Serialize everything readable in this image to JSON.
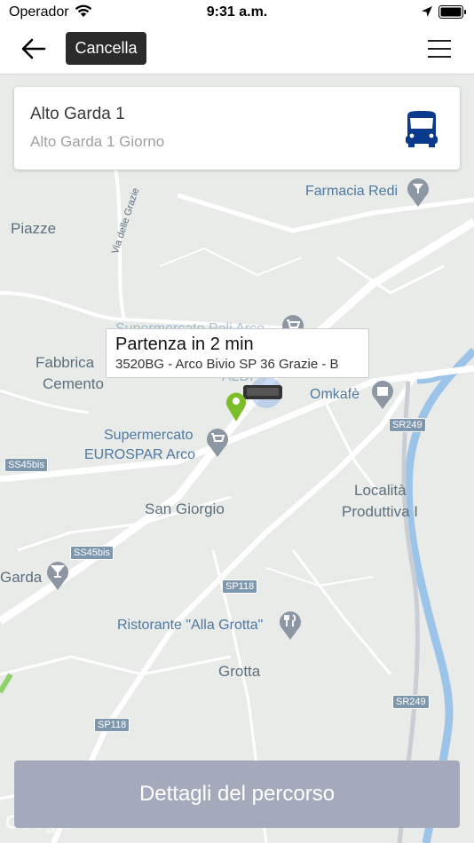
{
  "status_bar": {
    "carrier": "Operador",
    "time": "9:31 a.m."
  },
  "nav": {
    "cancel_label": "Cancella"
  },
  "route_card": {
    "name": "Alto Garda 1",
    "subtitle": "Alto Garda 1 Giorno"
  },
  "callout": {
    "title": "Partenza in 2 min",
    "stop": "3520BG - Arco Bivio SP 36 Grazie - B"
  },
  "map": {
    "places": [
      "Piazze",
      "Fabbrica",
      "Cemento",
      "San Giorgio",
      "Località",
      "Produttiva I",
      "Garda",
      "Grotta"
    ],
    "pois": [
      "Farmacia Redi",
      "Supermercato Poli Arco",
      "Omkafè",
      "Supermercato",
      "EUROSPAR Arco",
      "Ristorante \"Alla Grotta\"",
      "ALDI"
    ],
    "street": "Via delle Grazie",
    "road_tags": [
      "SS45bis",
      "SS45bis",
      "SP118",
      "SP118",
      "SR249",
      "SR249"
    ]
  },
  "details_button": "Dettagli del percorso",
  "logo": "Google",
  "colors": {
    "accent_blue": "#0b3a8c",
    "marker_green": "#7cbd2a",
    "button_disabled": "#a4aabb"
  }
}
